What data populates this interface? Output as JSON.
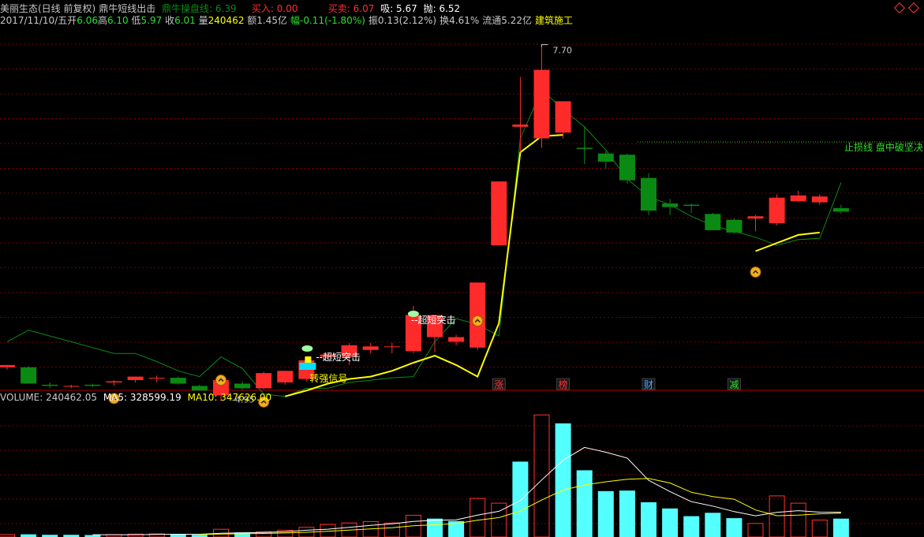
{
  "header": {
    "stock_name": "美丽生态(日线 前复权)",
    "indicator_name": "鼎牛短线出击",
    "line_label": "鼎牛操盘线: 6.39",
    "buy_label": "买入: 0.00",
    "trade_label": "买卖: 6.07",
    "absorb_label": "吸: 5.67",
    "throw_label": "抛: 6.52"
  },
  "quote": {
    "date": "2017/11/10/五",
    "open_label": "开",
    "open": "6.06",
    "high_label": "高",
    "high": "6.10",
    "low_label": "低",
    "low": "5.97",
    "close_label": "收",
    "close": "6.01",
    "vol_label": "量",
    "vol": "240462",
    "amount": "额1.45亿",
    "change": "幅-0.11(-1.80%)",
    "amplitude": "振0.13(2.12%)",
    "turnover": "换4.61%",
    "float_cap": "流通5.22亿",
    "sector": "建筑施工"
  },
  "annotations": {
    "high_price": "7.70",
    "low_price": "4.95",
    "stop_loss": "止损线 盘中破坚决",
    "super_short_1": "超短突击",
    "super_short_2": "超短突击",
    "strong_signal": "转强信号",
    "bottom_marks": [
      "涨",
      "榜",
      "财",
      "减"
    ]
  },
  "volume_header": {
    "volume": "VOLUME: 240462.05",
    "ma5": "MA5: 328599.19",
    "ma10": "MA10: 347626.00"
  },
  "colors": {
    "up": "#ff2b2b",
    "down": "#0a8a12",
    "volume_up": "#ff3030",
    "volume_down": "#54ffff",
    "green_text": "#2fe02f",
    "red_text": "#ff3030",
    "yellow": "#ffff00",
    "grid": "#7a0000"
  },
  "chart_data": {
    "type": "candlestick",
    "price_ylim": [
      4.8,
      7.82
    ],
    "candles": [
      {
        "o": 4.93,
        "h": 4.95,
        "l": 4.91,
        "c": 4.95
      },
      {
        "o": 4.93,
        "h": 4.94,
        "l": 4.79,
        "c": 4.79
      },
      {
        "o": 4.78,
        "h": 4.8,
        "l": 4.75,
        "c": 4.77
      },
      {
        "o": 4.77,
        "h": 4.78,
        "l": 4.75,
        "c": 4.77
      },
      {
        "o": 4.78,
        "h": 4.79,
        "l": 4.76,
        "c": 4.77
      },
      {
        "o": 4.8,
        "h": 4.82,
        "l": 4.77,
        "c": 4.81
      },
      {
        "o": 4.82,
        "h": 4.85,
        "l": 4.8,
        "c": 4.85
      },
      {
        "o": 4.84,
        "h": 4.86,
        "l": 4.8,
        "c": 4.84
      },
      {
        "o": 4.84,
        "h": 4.85,
        "l": 4.78,
        "c": 4.79
      },
      {
        "o": 4.77,
        "h": 4.78,
        "l": 4.73,
        "c": 4.73
      },
      {
        "o": 4.69,
        "h": 4.83,
        "l": 4.64,
        "c": 4.82
      },
      {
        "o": 4.79,
        "h": 4.81,
        "l": 4.74,
        "c": 4.75
      },
      {
        "o": 4.75,
        "h": 4.89,
        "l": 4.74,
        "c": 4.88
      },
      {
        "o": 4.8,
        "h": 4.9,
        "l": 4.78,
        "c": 4.9
      },
      {
        "o": 4.83,
        "h": 5.02,
        "l": 4.81,
        "c": 4.99
      },
      {
        "o": 5.02,
        "h": 5.05,
        "l": 5.0,
        "c": 5.04
      },
      {
        "o": 5.02,
        "h": 5.14,
        "l": 4.95,
        "c": 5.12
      },
      {
        "o": 5.08,
        "h": 5.14,
        "l": 5.05,
        "c": 5.11
      },
      {
        "o": 5.11,
        "h": 5.14,
        "l": 5.05,
        "c": 5.11
      },
      {
        "o": 5.07,
        "h": 5.46,
        "l": 5.05,
        "c": 5.38
      },
      {
        "o": 5.19,
        "h": 5.38,
        "l": 5.06,
        "c": 5.38
      },
      {
        "o": 5.15,
        "h": 5.21,
        "l": 5.12,
        "c": 5.19
      },
      {
        "o": 5.1,
        "h": 5.66,
        "l": 5.08,
        "c": 5.66
      },
      {
        "o": 5.98,
        "h": 6.53,
        "l": 5.98,
        "c": 6.53
      },
      {
        "o": 7.0,
        "h": 7.43,
        "l": 6.78,
        "c": 7.02
      },
      {
        "o": 6.9,
        "h": 7.7,
        "l": 6.82,
        "c": 7.49
      },
      {
        "o": 6.95,
        "h": 7.15,
        "l": 6.9,
        "c": 7.22
      },
      {
        "o": 6.82,
        "h": 7.0,
        "l": 6.68,
        "c": 6.81
      },
      {
        "o": 6.77,
        "h": 6.79,
        "l": 6.64,
        "c": 6.7
      },
      {
        "o": 6.76,
        "h": 6.77,
        "l": 6.51,
        "c": 6.54
      },
      {
        "o": 6.56,
        "h": 6.6,
        "l": 6.24,
        "c": 6.28
      },
      {
        "o": 6.34,
        "h": 6.38,
        "l": 6.24,
        "c": 6.31
      },
      {
        "o": 6.33,
        "h": 6.34,
        "l": 6.26,
        "c": 6.32
      },
      {
        "o": 6.25,
        "h": 6.26,
        "l": 6.11,
        "c": 6.11
      },
      {
        "o": 6.2,
        "h": 6.21,
        "l": 6.08,
        "c": 6.09
      },
      {
        "o": 6.21,
        "h": 6.24,
        "l": 6.1,
        "c": 6.23
      },
      {
        "o": 6.17,
        "h": 6.42,
        "l": 6.15,
        "c": 6.39
      },
      {
        "o": 6.36,
        "h": 6.45,
        "l": 6.35,
        "c": 6.41
      },
      {
        "o": 6.35,
        "h": 6.42,
        "l": 6.33,
        "c": 6.4
      },
      {
        "o": 6.3,
        "h": 6.33,
        "l": 6.25,
        "c": 6.27
      }
    ],
    "green_line": [
      5.15,
      5.25,
      5.2,
      5.15,
      5.1,
      5.05,
      5.05,
      4.98,
      4.9,
      4.85,
      5.02,
      4.92,
      4.7,
      4.68,
      4.75,
      4.75,
      4.8,
      4.82,
      4.84,
      4.85,
      5.15,
      5.35,
      5.3,
      5.2,
      6.9,
      7.32,
      7.15,
      7.0,
      6.8,
      6.55,
      6.4,
      6.33,
      6.23,
      6.15,
      6.1,
      6.05,
      5.98,
      6.03,
      6.04,
      6.52
    ],
    "yellow_line": [
      null,
      null,
      null,
      null,
      null,
      null,
      null,
      null,
      null,
      null,
      null,
      null,
      null,
      4.68,
      4.73,
      4.79,
      4.83,
      4.85,
      4.9,
      4.97,
      5.03,
      4.95,
      4.85,
      5.31,
      6.78,
      6.92,
      6.93,
      null,
      null,
      null,
      null,
      null,
      null,
      null,
      null,
      5.93,
      6.0,
      6.07,
      6.09,
      null
    ],
    "stop_loss_level": 6.87,
    "volume_ylim": [
      0,
      535000
    ],
    "volume": [
      10000,
      11000,
      9000,
      9000,
      8000,
      10000,
      12000,
      13000,
      12000,
      9000,
      32000,
      19000,
      22000,
      28000,
      40000,
      52000,
      58000,
      64000,
      58000,
      90000,
      76000,
      66000,
      160000,
      140000,
      312000,
      505000,
      470000,
      276000,
      190000,
      192000,
      144000,
      118000,
      86000,
      100000,
      78000,
      56000,
      170000,
      140000,
      70000,
      76000
    ],
    "volume_ma5": [
      null,
      null,
      null,
      null,
      9400,
      9400,
      9600,
      10400,
      11400,
      11200,
      15600,
      17000,
      18800,
      22000,
      28200,
      32200,
      40000,
      48400,
      54400,
      64400,
      69600,
      70800,
      90800,
      106400,
      150800,
      235800,
      317400,
      370600,
      350600,
      326600,
      234400,
      188000,
      146000,
      128000,
      105200,
      87600,
      102000,
      108800,
      102800,
      102400
    ],
    "volume_ma10": [
      null,
      null,
      null,
      null,
      null,
      null,
      null,
      null,
      null,
      10300,
      12500,
      13300,
      14600,
      16500,
      19700,
      23900,
      28500,
      33600,
      38200,
      46300,
      50700,
      55400,
      69200,
      80400,
      107600,
      152900,
      194100,
      215300,
      228500,
      238700,
      242100,
      223400,
      185000,
      167400,
      156200,
      111800,
      88200,
      90400,
      95800,
      98800
    ],
    "volume_up_flags": [
      true,
      false,
      false,
      false,
      false,
      true,
      true,
      true,
      false,
      false,
      true,
      false,
      true,
      true,
      true,
      true,
      true,
      true,
      true,
      true,
      false,
      false,
      true,
      true,
      false,
      true,
      false,
      false,
      false,
      false,
      false,
      false,
      false,
      false,
      false,
      true,
      true,
      true,
      true,
      false
    ]
  }
}
